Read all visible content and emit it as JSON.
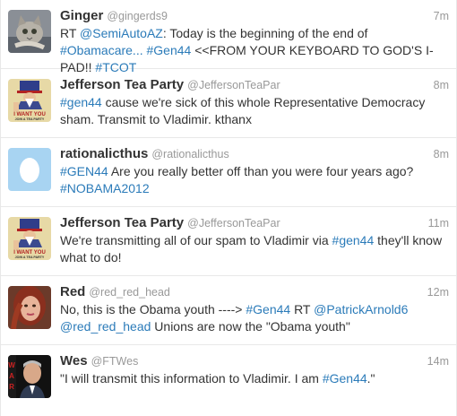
{
  "colors": {
    "link": "#2b7bb9",
    "muted": "#999999",
    "text": "#333333",
    "divider": "#e8e8e8"
  },
  "tweets": [
    {
      "name": "Ginger",
      "handle": "@gingerds9",
      "time": "7m",
      "avatar_icon": "cat-photo-avatar",
      "lines": [
        [
          {
            "t": "RT "
          },
          {
            "t": "@SemiAutoAZ",
            "link": true
          },
          {
            "t": ": Today is the beginning of the end of"
          }
        ],
        [
          {
            "t": "#Obamacare...",
            "link": true
          },
          {
            "t": " "
          },
          {
            "t": "#Gen44",
            "link": true
          },
          {
            "t": " <<FROM YOUR KEYBOARD TO GOD'S I-"
          }
        ],
        [
          {
            "t": "PAD!! "
          },
          {
            "t": "#TCOT",
            "link": true
          }
        ]
      ]
    },
    {
      "name": "Jefferson Tea Party",
      "handle": "@JeffersonTeaPar",
      "time": "8m",
      "avatar_icon": "uncle-sam-poster-avatar",
      "avatar_text": [
        "I WANT YOU",
        "JOIN A TEA PARTY"
      ],
      "lines": [
        [
          {
            "t": "#gen44",
            "link": true
          },
          {
            "t": " cause we're sick of this whole Representative Democracy"
          }
        ],
        [
          {
            "t": "sham. Transmit to Vladimir. kthanx"
          }
        ]
      ]
    },
    {
      "name": "rationalicthus",
      "handle": "@rationalicthus",
      "time": "8m",
      "avatar_icon": "default-egg-avatar",
      "lines": [
        [
          {
            "t": "#GEN44",
            "link": true
          },
          {
            "t": " Are you really better off than you were four years ago?"
          }
        ],
        [
          {
            "t": "#NOBAMA2012",
            "link": true
          }
        ]
      ]
    },
    {
      "name": "Jefferson Tea Party",
      "handle": "@JeffersonTeaPar",
      "time": "11m",
      "avatar_icon": "uncle-sam-poster-avatar",
      "avatar_text": [
        "I WANT YOU",
        "JOIN A TEA PARTY"
      ],
      "lines": [
        [
          {
            "t": "We're transmitting all of our spam to Vladimir via "
          },
          {
            "t": "#gen44",
            "link": true
          },
          {
            "t": " they'll know"
          }
        ],
        [
          {
            "t": "what to do!"
          }
        ]
      ]
    },
    {
      "name": "Red",
      "handle": "@red_red_head",
      "time": "12m",
      "avatar_icon": "redhead-photo-avatar",
      "lines": [
        [
          {
            "t": "No, this is the Obama youth ----> "
          },
          {
            "t": "#Gen44",
            "link": true
          },
          {
            "t": " RT "
          },
          {
            "t": "@PatrickArnold6",
            "link": true
          }
        ],
        [
          {
            "t": "@red_red_head",
            "link": true
          },
          {
            "t": " Unions are now the \"Obama youth\""
          }
        ]
      ]
    },
    {
      "name": "Wes",
      "handle": "@FTWes",
      "time": "14m",
      "avatar_icon": "man-photo-avatar",
      "lines": [
        [
          {
            "t": "\"I will transmit this information to Vladimir. I am "
          },
          {
            "t": "#Gen44",
            "link": true
          },
          {
            "t": ".\""
          }
        ]
      ]
    }
  ]
}
